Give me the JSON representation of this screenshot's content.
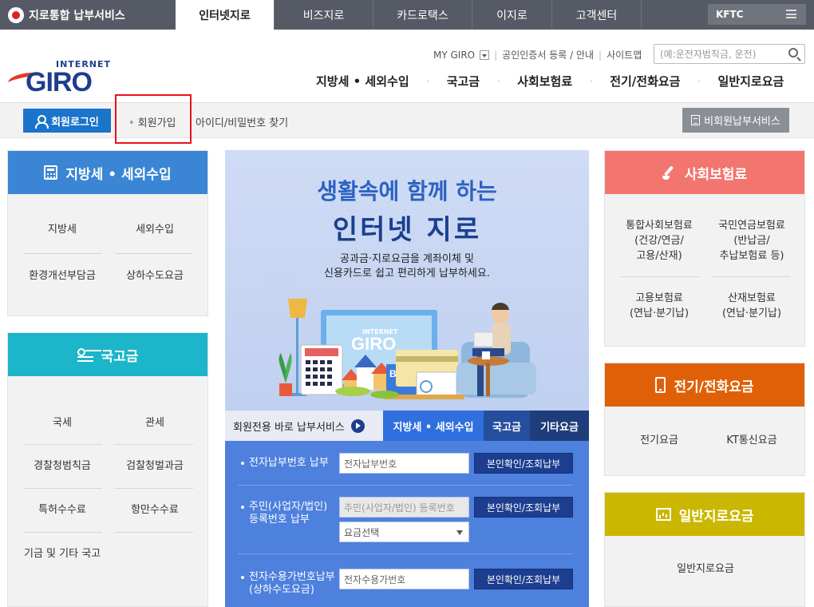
{
  "topbar": {
    "brand": "지로통합 납부서비스",
    "tabs": [
      "인터넷지로",
      "비즈지로",
      "카드로택스",
      "이지로",
      "고객센터"
    ],
    "kftc": "KFTC"
  },
  "header": {
    "logo_small": "INTERNET",
    "logo_big": "GIRO",
    "util": {
      "mygiro": "MY GIRO",
      "cert": "공인인증서 등록 / 안내",
      "sitemap": "사이트맵"
    },
    "search_placeholder": "(예:운전자범칙금, 운전)",
    "nav": [
      "지방세 • 세외수입",
      "국고금",
      "사회보험료",
      "전기/전화요금",
      "일반지로요금"
    ]
  },
  "loginbar": {
    "login": "회원로그인",
    "signup": "회원가입",
    "find": "아이디/비밀번호 찾기",
    "guest": "비회원납부서비스"
  },
  "left": {
    "local": {
      "title": "지방세 • 세외수입",
      "items": [
        "지방세",
        "세외수입",
        "환경개선부담금",
        "상하수도요금"
      ]
    },
    "national": {
      "title": "국고금",
      "items": [
        "국세",
        "관세",
        "경찰청범칙금",
        "검찰청벌과금",
        "특허수수료",
        "항만수수료",
        "기금 및 기타 국고"
      ]
    }
  },
  "hero": {
    "line1": "생활속에 함께 하는",
    "line2": "인터넷 지로",
    "desc1": "공과금·지로요금을 계좌이체 및",
    "desc2": "신용카드로 쉽고 편리하게 납부하세요.",
    "screen_small": "INTERNET",
    "screen_big": "GIRO",
    "bank": "Bank"
  },
  "tabs": {
    "member": "회원전용 바로 납부서비스",
    "local": "지방세 • 세외수입",
    "national": "국고금",
    "etc": "기타요금"
  },
  "form": {
    "row1_label": "전자납부번호 납부",
    "row1_placeholder": "전자납부번호",
    "row2_label1": "주민(사업자/법인)",
    "row2_label2": "등록번호 납부",
    "row2_placeholder": "주민(사업자/법인) 등록번호",
    "row2_select": "요금선택",
    "row3_label1": "전자수용가번호납부",
    "row3_label2": "(상하수도요금)",
    "row3_placeholder": "전자수용가번호",
    "button": "본인확인/조회납부"
  },
  "right": {
    "social": {
      "title": "사회보험료",
      "i1a": "통합사회보험료",
      "i1b": "(건강/연금/",
      "i1c": "고용/산재)",
      "i2a": "국민연금보험료",
      "i2b": "(반납금/",
      "i2c": "추납보험료 등)",
      "i3a": "고용보험료",
      "i3b": "(연납·분기납)",
      "i4a": "산재보험료",
      "i4b": "(연납·분기납)"
    },
    "phone": {
      "title": "전기/전화요금",
      "items": [
        "전기요금",
        "KT통신요금"
      ]
    },
    "general": {
      "title": "일반지로요금",
      "items": [
        "일반지로요금"
      ]
    }
  },
  "colors": {
    "local_head": "#3a86d4",
    "national_head": "#1cb5c9",
    "social_head": "#f2766f",
    "phone_head": "#e06008",
    "general_head": "#cbb701",
    "highlight": "#e8131e"
  }
}
